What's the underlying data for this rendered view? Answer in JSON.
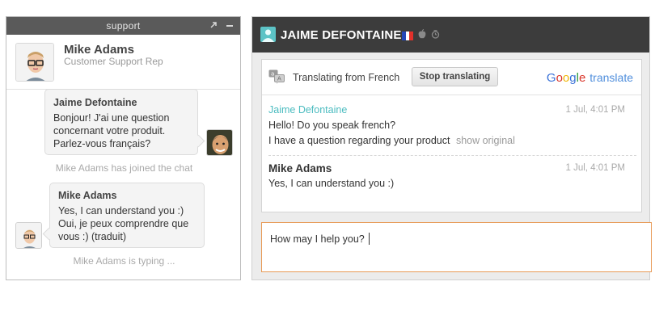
{
  "left_widget": {
    "bar_title": "support",
    "popout_icon": "popout-arrow-icon",
    "minimize_icon": "minimize-icon",
    "agent_name": "Mike Adams",
    "agent_role": "Customer Support Rep",
    "messages": [
      {
        "author": "Jaime Defontaine",
        "lines": [
          "Bonjour! J'ai une question",
          "concernant votre produit.",
          "Parlez-vous français?"
        ]
      },
      {
        "author": "Mike Adams",
        "lines": [
          "Yes, I can understand you :)",
          "Oui, je peux comprendre que",
          "vous :) (traduit)"
        ]
      }
    ],
    "system_joined": "Mike Adams has joined the chat",
    "system_typing": "Mike Adams is typing ..."
  },
  "right_widget": {
    "visitor_name": "JAIME DEFONTAINE",
    "indicators": [
      "france-flag-icon",
      "apple-icon",
      "clock-icon"
    ],
    "translate_bar": {
      "text": "Translating from French",
      "button": "Stop translating",
      "google_brand": [
        "G",
        "o",
        "o",
        "g",
        "l",
        "e"
      ],
      "translate_word": "translate"
    },
    "messages": [
      {
        "author": "Jaime Defontaine",
        "time": "1 Jul, 4:01 PM",
        "lines": [
          "Hello! Do you speak french?",
          "I have a question regarding your product"
        ],
        "show_original": "show original"
      },
      {
        "author": "Mike Adams",
        "time": "1 Jul, 4:01 PM",
        "lines": [
          "Yes, I can understand you :)"
        ]
      }
    ],
    "composer_value": "How may I help you?"
  },
  "colors": {
    "accent_teal": "#4cbcc0",
    "composer_border": "#e89a56",
    "dark_bar": "#3c3c3c"
  }
}
